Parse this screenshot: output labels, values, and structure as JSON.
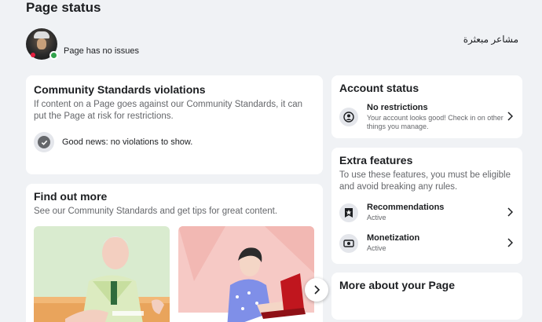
{
  "header": {
    "title": "Page status"
  },
  "profile": {
    "status": "Page has no issues",
    "page_name": "مشاعر مبعثرة"
  },
  "violations": {
    "title": "Community Standards violations",
    "description": "If content on a Page goes against our Community Standards, it can put the Page at risk for restrictions.",
    "good_news": "Good news: no violations to show."
  },
  "find_out": {
    "title": "Find out more",
    "description": "See our Community Standards and get tips for great content."
  },
  "account_status": {
    "title": "Account status",
    "item_label": "No restrictions",
    "item_sub": "Your account looks good! Check in on other things you manage."
  },
  "extra_features": {
    "title": "Extra features",
    "description": "To use these features, you must be eligible and avoid breaking any rules.",
    "items": [
      {
        "label": "Recommendations",
        "status": "Active"
      },
      {
        "label": "Monetization",
        "status": "Active"
      }
    ]
  },
  "more_about": {
    "title": "More about your Page"
  }
}
